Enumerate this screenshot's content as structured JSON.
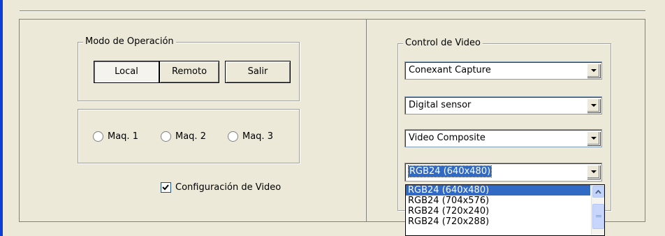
{
  "operation_mode": {
    "legend": "Modo de Operación",
    "local_label": "Local",
    "remote_label": "Remoto",
    "exit_label": "Salir"
  },
  "machines": [
    {
      "label": "Maq. 1",
      "selected": false
    },
    {
      "label": "Maq. 2",
      "selected": false
    },
    {
      "label": "Maq. 3",
      "selected": false
    }
  ],
  "video_config": {
    "label": "Configuración de Video",
    "checked": true
  },
  "video_control": {
    "legend": "Control de Video",
    "device_value": "Conexant Capture",
    "source_value": "Digital sensor",
    "input_value": "Video Composite",
    "format_value": "RGB24 (640x480)",
    "format_options": [
      "RGB24 (640x480)",
      "RGB24 (704x576)",
      "RGB24 (720x240)",
      "RGB24 (720x288)"
    ]
  },
  "icons": {
    "dropdown": "chevron-down-icon",
    "scroll_up": "scroll-up-icon",
    "checkbox": "checkmark-icon"
  },
  "colors": {
    "selection": "#316ac5",
    "accent_bar": "#0a3fd8"
  }
}
